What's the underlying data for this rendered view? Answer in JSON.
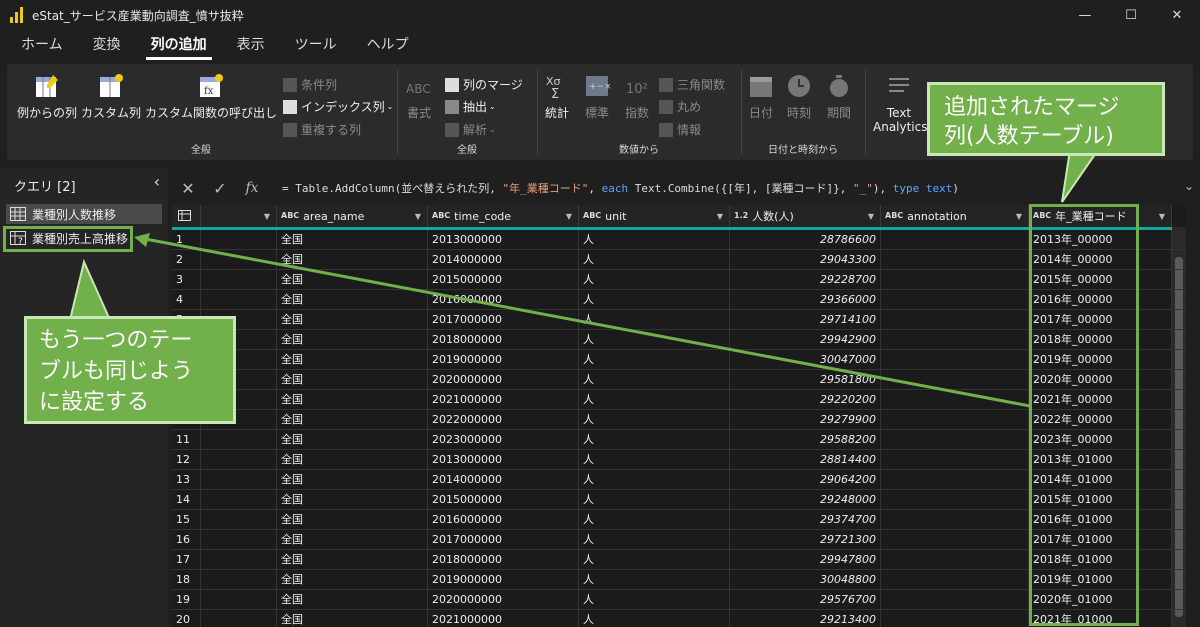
{
  "window": {
    "title": "eStat_サービス産業動向調査_憤サ抜粋"
  },
  "menu": {
    "tabs": [
      "ホーム",
      "変換",
      "列の追加",
      "表示",
      "ツール",
      "ヘルプ"
    ],
    "active": "列の追加"
  },
  "ribbon": {
    "general": {
      "label": "全般",
      "from_examples": "例からの列",
      "custom_column": "カスタム列",
      "invoke_custom_function": "カスタム関数の呼び出し",
      "conditional_column": "条件列",
      "index_column": "インデックス列",
      "duplicate_column": "重複する列"
    },
    "text": {
      "label": "全般",
      "format": "書式",
      "merge_columns": "列のマージ",
      "extract": "抽出",
      "parse": "解析"
    },
    "number": {
      "label": "数値から",
      "statistics": "統計",
      "standard": "標準",
      "scientific": "指数",
      "trigonometry": "三角関数",
      "rounding": "丸め",
      "information": "情報"
    },
    "datetime": {
      "label": "日付と時刻から",
      "date": "日付",
      "time": "時刻",
      "duration": "期間"
    },
    "ai": {
      "text_analytics": "Text Analytics"
    }
  },
  "queries": {
    "header": "クエリ [2]",
    "items": [
      "業種別人数推移",
      "業種別売上高推移"
    ]
  },
  "formula": "= Table.AddColumn(並べ替えられた列, \"年_業種コード\", each Text.Combine({[年], [業種コード]}, \"_\"), type text)",
  "columns": [
    {
      "type": "",
      "name": ""
    },
    {
      "type": "ABC",
      "name": "area_name"
    },
    {
      "type": "ABC",
      "name": "time_code"
    },
    {
      "type": "ABC",
      "name": "unit"
    },
    {
      "type": "1.2",
      "name": "人数(人)"
    },
    {
      "type": "ABC",
      "name": "annotation"
    },
    {
      "type": "ABC",
      "name": "年_業種コード"
    }
  ],
  "rows": [
    [
      "1",
      "",
      "全国",
      "2013000000",
      "人",
      "28786600",
      "",
      "2013年_00000"
    ],
    [
      "2",
      "",
      "全国",
      "2014000000",
      "人",
      "29043300",
      "",
      "2014年_00000"
    ],
    [
      "3",
      "",
      "全国",
      "2015000000",
      "人",
      "29228700",
      "",
      "2015年_00000"
    ],
    [
      "4",
      "",
      "全国",
      "2016000000",
      "人",
      "29366000",
      "",
      "2016年_00000"
    ],
    [
      "5",
      "",
      "全国",
      "2017000000",
      "人",
      "29714100",
      "",
      "2017年_00000"
    ],
    [
      "6",
      "",
      "全国",
      "2018000000",
      "人",
      "29942900",
      "",
      "2018年_00000"
    ],
    [
      "7",
      "",
      "全国",
      "2019000000",
      "人",
      "30047000",
      "",
      "2019年_00000"
    ],
    [
      "8",
      "",
      "全国",
      "2020000000",
      "人",
      "29581800",
      "",
      "2020年_00000"
    ],
    [
      "9",
      "",
      "全国",
      "2021000000",
      "人",
      "29220200",
      "",
      "2021年_00000"
    ],
    [
      "10",
      "",
      "全国",
      "2022000000",
      "人",
      "29279900",
      "",
      "2022年_00000"
    ],
    [
      "11",
      "",
      "全国",
      "2023000000",
      "人",
      "29588200",
      "",
      "2023年_00000"
    ],
    [
      "12",
      "",
      "全国",
      "2013000000",
      "人",
      "28814400",
      "",
      "2013年_01000"
    ],
    [
      "13",
      "",
      "全国",
      "2014000000",
      "人",
      "29064200",
      "",
      "2014年_01000"
    ],
    [
      "14",
      "",
      "全国",
      "2015000000",
      "人",
      "29248000",
      "",
      "2015年_01000"
    ],
    [
      "15",
      "",
      "全国",
      "2016000000",
      "人",
      "29374700",
      "",
      "2016年_01000"
    ],
    [
      "16",
      "",
      "全国",
      "2017000000",
      "人",
      "29721300",
      "",
      "2017年_01000"
    ],
    [
      "17",
      "",
      "全国",
      "2018000000",
      "人",
      "29947800",
      "",
      "2018年_01000"
    ],
    [
      "18",
      "",
      "全国",
      "2019000000",
      "人",
      "30048800",
      "",
      "2019年_01000"
    ],
    [
      "19",
      "",
      "全国",
      "2020000000",
      "人",
      "29576700",
      "",
      "2020年_01000"
    ],
    [
      "20",
      "",
      "全国",
      "2021000000",
      "人",
      "29213400",
      "",
      "2021年_01000"
    ]
  ],
  "callouts": {
    "merge_column": "追加されたマージ列(人数テーブル)",
    "merge_lines": [
      "追加されたマージ",
      "列(人数テーブル)"
    ],
    "other_table_lines": [
      "もう一つのテー",
      "ブルも同じよう",
      "に設定する"
    ]
  },
  "colors": {
    "accent_green": "#71b04a",
    "header_teal": "#13a89e",
    "logo_yellow": "#f2c811"
  }
}
